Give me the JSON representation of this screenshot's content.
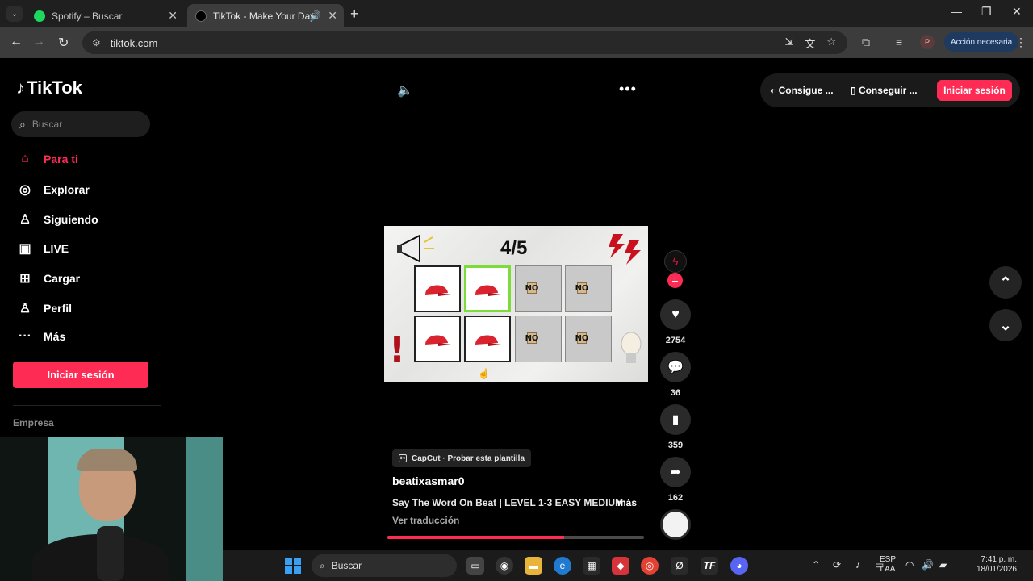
{
  "browser": {
    "tabs": [
      {
        "title": "Spotify – Buscar",
        "favicon_color": "#1ed760",
        "active": false
      },
      {
        "title": "TikTok - Make Your Day",
        "favicon_color": "#000000",
        "active": true
      }
    ],
    "url": "tiktok.com",
    "profile_initial": "P",
    "action_button": "Acción necesaria"
  },
  "tiktok": {
    "logo_text": "TikTok",
    "search_placeholder": "Buscar",
    "nav": [
      {
        "label": "Para ti",
        "icon": "home-icon"
      },
      {
        "label": "Explorar",
        "icon": "compass-icon"
      },
      {
        "label": "Siguiendo",
        "icon": "following-icon"
      },
      {
        "label": "LIVE",
        "icon": "live-icon"
      },
      {
        "label": "Cargar",
        "icon": "upload-icon"
      },
      {
        "label": "Perfil",
        "icon": "profile-icon"
      },
      {
        "label": "Más",
        "icon": "more-icon"
      }
    ],
    "login_sidebar": "Iniciar sesión",
    "footer_heading": "Empresa",
    "top_actions": {
      "coins": "Consigue ...",
      "app": "Conseguir ...",
      "login": "Iniciar sesión"
    },
    "video": {
      "counter": "4/5",
      "no_text": "NO",
      "progress": 0.69
    },
    "rail": {
      "likes": "2754",
      "comments": "36",
      "saves": "359",
      "shares": "162"
    },
    "caption": {
      "capcut_label": "CapCut · Probar esta plantilla",
      "username": "beatixasmar0",
      "description": "Say The Word On Beat | LEVEL 1-3 EASY MEDIUM",
      "more": "más",
      "translate": "Ver traducción"
    }
  },
  "taskbar": {
    "search_placeholder": "Buscar",
    "lang_top": "ESP",
    "lang_bottom": "LAA",
    "time": "7:41 p. m.",
    "date": "18/01/2026"
  },
  "colors": {
    "accent": "#fe2c55",
    "highlight": "#7cdc3a"
  }
}
